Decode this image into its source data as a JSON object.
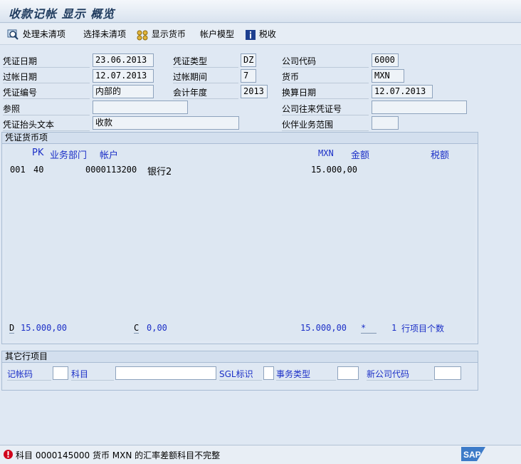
{
  "window": {
    "title": "收款记帐 显示 概览"
  },
  "toolbar": {
    "process_open": "处理未清项",
    "select_open": "选择未清项",
    "display_currency": "显示货币",
    "account_model": "帐户模型",
    "tax": "税收"
  },
  "header": {
    "doc_date": {
      "label": "凭证日期",
      "value": "23.06.2013"
    },
    "doc_type": {
      "label": "凭证类型",
      "value": "DZ"
    },
    "company_code": {
      "label": "公司代码",
      "value": "6000"
    },
    "posting_date": {
      "label": "过帐日期",
      "value": "12.07.2013"
    },
    "period": {
      "label": "过帐期间",
      "value": "7"
    },
    "currency": {
      "label": "货币",
      "value": "MXN"
    },
    "doc_number": {
      "label": "凭证编号",
      "value": "内部的"
    },
    "fiscal_year": {
      "label": "会计年度",
      "value": "2013"
    },
    "translation_date": {
      "label": "换算日期",
      "value": "12.07.2013"
    },
    "reference": {
      "label": "参照",
      "value": ""
    },
    "cross_company": {
      "label": "公司往来凭证号",
      "value": ""
    },
    "header_text": {
      "label": "凭证抬头文本",
      "value": "收款"
    },
    "partner_ba": {
      "label": "伙伴业务范围",
      "value": ""
    }
  },
  "items_group": {
    "title": "凭证货币项",
    "columns": {
      "pk": "PK",
      "business_area": "业务部门",
      "account": "帐户",
      "currency": "MXN",
      "amount": "金额",
      "tax": "税额"
    },
    "rows": [
      {
        "item": "001",
        "pk": "40",
        "account": "0000113200",
        "name": "银行2",
        "amount": "15.000,00"
      }
    ],
    "totals": {
      "debit_label": "D",
      "debit": "15.000,00",
      "credit_label": "C",
      "credit": "0,00",
      "balance": "15.000,00",
      "balance_flag": "*",
      "item_count": "1",
      "item_count_label": "行项目个数"
    }
  },
  "other_group": {
    "title": "其它行项目",
    "posting_key": {
      "label": "记帐码",
      "value": ""
    },
    "account": {
      "label": "科目",
      "value": ""
    },
    "sgl": {
      "label": "SGL标识",
      "value": ""
    },
    "trans_type": {
      "label": "事务类型",
      "value": ""
    },
    "new_company": {
      "label": "新公司代码",
      "value": ""
    }
  },
  "status": {
    "message": "科目 0000145000 货币 MXN 的汇率差额科目不完整",
    "type": "error"
  },
  "colors": {
    "link_blue": "#1b2fc7",
    "error_red": "#d0021b",
    "bg": "#dfe8f3"
  }
}
